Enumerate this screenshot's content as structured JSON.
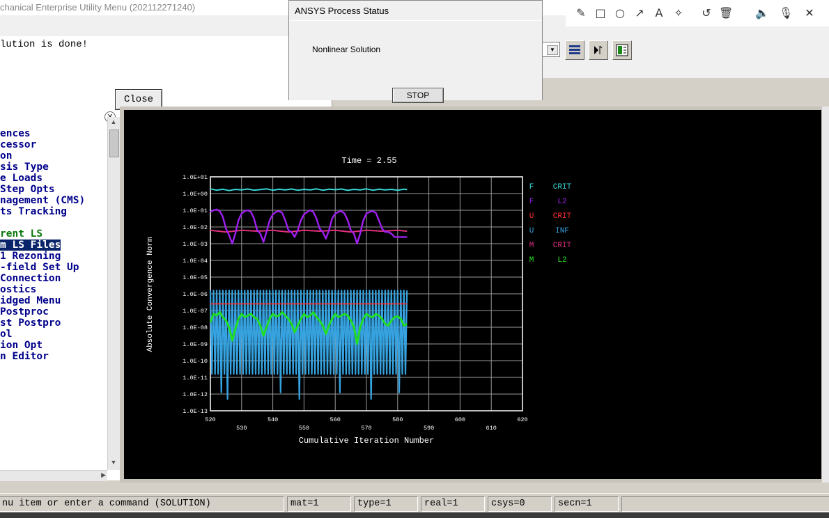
{
  "app": {
    "title": "chanical Enterprise Utility Menu (202112271240)"
  },
  "message_dialog": {
    "text": "lution is done!",
    "close_label": "Close"
  },
  "process_dialog": {
    "title": "ANSYS Process Status",
    "status": "Nonlinear Solution",
    "stop_label": "STOP"
  },
  "annotation_toolbar": {
    "icons": [
      "pencil-icon",
      "rectangle-icon",
      "circle-icon",
      "arrow-icon",
      "text-icon",
      "highlighter-icon",
      "undo-icon",
      "trash-icon",
      "speaker-icon",
      "microphone-icon",
      "close-icon"
    ]
  },
  "tree": {
    "items": [
      {
        "label": "ences",
        "style": "normal"
      },
      {
        "label": "cessor",
        "style": "normal"
      },
      {
        "label": "on",
        "style": "normal"
      },
      {
        "label": "sis Type",
        "style": "normal"
      },
      {
        "label": "e Loads",
        "style": "normal"
      },
      {
        "label": "Step Opts",
        "style": "normal"
      },
      {
        "label": "nagement (CMS)",
        "style": "normal"
      },
      {
        "label": "ts Tracking",
        "style": "normal"
      },
      {
        "label": "",
        "style": "normal"
      },
      {
        "label": "rent LS",
        "style": "green"
      },
      {
        "label": "m LS Files",
        "style": "sel"
      },
      {
        "label": "1 Rezoning",
        "style": "normal"
      },
      {
        "label": "-field Set Up",
        "style": "normal"
      },
      {
        "label": " Connection",
        "style": "normal"
      },
      {
        "label": "ostics",
        "style": "normal"
      },
      {
        "label": "idged Menu",
        "style": "normal"
      },
      {
        "label": " Postproc",
        "style": "normal"
      },
      {
        "label": "st Postpro",
        "style": "normal"
      },
      {
        "label": "ol",
        "style": "normal"
      },
      {
        "label": "ion Opt",
        "style": "normal"
      },
      {
        "label": "n Editor",
        "style": "normal"
      }
    ]
  },
  "status_bar": {
    "prompt": "nu item or enter a command (SOLUTION)",
    "mat": "mat=1",
    "type": "type=1",
    "real": "real=1",
    "csys": "csys=0",
    "secn": "secn=1"
  },
  "chart_data": {
    "type": "line",
    "title": "Time = 2.55",
    "xlabel": "Cumulative Iteration Number",
    "ylabel": "Absolute Convergence Norm",
    "xlim": [
      520,
      620
    ],
    "ylim_log10": [
      -13,
      1
    ],
    "yscale": "log",
    "background": "#000000",
    "x_ticks_top": [
      "520",
      "540",
      "560",
      "580",
      "600",
      "620"
    ],
    "x_ticks_bottom": [
      "530",
      "550",
      "570",
      "590",
      "610"
    ],
    "y_ticks": [
      "1.0E+01",
      "1.0E+00",
      "1.0E-01",
      "1.0E-02",
      "1.0E-03",
      "1.0E-04",
      "1.0E-05",
      "1.0E-06",
      "1.0E-07",
      "1.0E-08",
      "1.0E-09",
      "1.0E-10",
      "1.0E-11",
      "1.0E-12",
      "1.0E-13"
    ],
    "series": [
      {
        "letter": "F",
        "name": "CRIT",
        "color": "#3ad6d6",
        "width": 2,
        "x": [
          520,
          522,
          524,
          526,
          528,
          530,
          532,
          534,
          536,
          538,
          540,
          542,
          544,
          546,
          548,
          550,
          552,
          554,
          556,
          558,
          560,
          562,
          564,
          566,
          568,
          570,
          572,
          574,
          576,
          578,
          580,
          582,
          583
        ],
        "log10": [
          0.28,
          0.2,
          0.26,
          0.18,
          0.25,
          0.22,
          0.27,
          0.2,
          0.24,
          0.28,
          0.2,
          0.26,
          0.22,
          0.27,
          0.2,
          0.25,
          0.22,
          0.28,
          0.2,
          0.26,
          0.23,
          0.27,
          0.19,
          0.25,
          0.22,
          0.28,
          0.2,
          0.26,
          0.22,
          0.25,
          0.2,
          0.26,
          0.24
        ]
      },
      {
        "letter": "F",
        "name": "L2",
        "color": "#a020f0",
        "width": 2.4,
        "x": [
          520,
          521,
          522,
          523,
          524,
          525,
          526,
          527,
          528,
          529,
          530,
          531,
          532,
          533,
          534,
          535,
          536,
          537,
          538,
          539,
          540,
          541,
          542,
          543,
          544,
          545,
          546,
          547,
          548,
          549,
          550,
          551,
          552,
          553,
          554,
          555,
          556,
          557,
          558,
          559,
          560,
          561,
          562,
          563,
          564,
          565,
          566,
          567,
          568,
          569,
          570,
          571,
          572,
          573,
          574,
          575,
          576,
          577,
          578,
          579,
          580,
          581,
          582,
          583
        ],
        "log10": [
          -1.1,
          -1.0,
          -0.95,
          -1.05,
          -1.4,
          -2.1,
          -2.5,
          -3.0,
          -2.4,
          -1.6,
          -1.2,
          -1.05,
          -1.0,
          -1.1,
          -1.5,
          -2.2,
          -2.4,
          -2.9,
          -2.3,
          -1.6,
          -1.25,
          -1.1,
          -1.05,
          -1.15,
          -1.6,
          -2.2,
          -2.3,
          -2.6,
          -2.2,
          -1.6,
          -1.25,
          -1.1,
          -1.0,
          -1.1,
          -1.5,
          -2.1,
          -2.3,
          -2.7,
          -2.2,
          -1.5,
          -1.2,
          -1.1,
          -1.05,
          -1.2,
          -1.6,
          -2.2,
          -2.4,
          -3.0,
          -2.4,
          -1.6,
          -1.2,
          -1.1,
          -1.05,
          -1.15,
          -1.6,
          -2.1,
          -2.3,
          -2.3,
          -2.4,
          -2.6,
          -2.6,
          -2.6,
          -2.6,
          -2.6
        ]
      },
      {
        "letter": "U",
        "name": "CRIT",
        "color": "#ff3030",
        "width": 1.6,
        "x": [
          520,
          583
        ],
        "log10": [
          -6.6,
          -6.6
        ]
      },
      {
        "letter": "U",
        "name": "INF",
        "color": "#36a3e0",
        "width": 2.2,
        "x": [],
        "log10": []
      },
      {
        "letter": "M",
        "name": "CRIT",
        "color": "#e0307e",
        "width": 2,
        "x": [
          520,
          525,
          530,
          535,
          540,
          545,
          550,
          555,
          560,
          565,
          570,
          575,
          580,
          583
        ],
        "log10": [
          -2.2,
          -2.3,
          -2.2,
          -2.25,
          -2.2,
          -2.3,
          -2.2,
          -2.25,
          -2.2,
          -2.3,
          -2.2,
          -2.25,
          -2.2,
          -2.25
        ]
      },
      {
        "letter": "M",
        "name": "L2",
        "color": "#20e020",
        "width": 2.8,
        "x": [
          520,
          521,
          522,
          523,
          524,
          525,
          526,
          527,
          528,
          529,
          530,
          531,
          532,
          533,
          534,
          535,
          536,
          537,
          538,
          539,
          540,
          541,
          542,
          543,
          544,
          545,
          546,
          547,
          548,
          549,
          550,
          551,
          552,
          553,
          554,
          555,
          556,
          557,
          558,
          559,
          560,
          561,
          562,
          563,
          564,
          565,
          566,
          567,
          568,
          569,
          570,
          571,
          572,
          573,
          574,
          575,
          576,
          577,
          578,
          579,
          580,
          581,
          582,
          583
        ],
        "log10": [
          -7.7,
          -7.2,
          -7.3,
          -7.1,
          -7.4,
          -7.6,
          -8.0,
          -8.8,
          -8.1,
          -7.5,
          -7.2,
          -7.4,
          -7.3,
          -7.2,
          -7.4,
          -7.5,
          -7.9,
          -8.5,
          -8.0,
          -7.5,
          -7.2,
          -7.35,
          -7.3,
          -7.1,
          -7.3,
          -7.5,
          -7.8,
          -8.3,
          -7.9,
          -7.5,
          -7.2,
          -7.4,
          -7.3,
          -7.1,
          -7.4,
          -7.6,
          -7.9,
          -8.4,
          -7.9,
          -7.5,
          -7.2,
          -7.4,
          -7.3,
          -7.2,
          -7.3,
          -7.6,
          -8.0,
          -9.0,
          -8.0,
          -7.5,
          -7.2,
          -7.35,
          -7.4,
          -7.2,
          -7.3,
          -7.5,
          -7.8,
          -7.9,
          -7.6,
          -7.4,
          -7.35,
          -7.5,
          -7.9,
          -7.8
        ]
      }
    ]
  }
}
